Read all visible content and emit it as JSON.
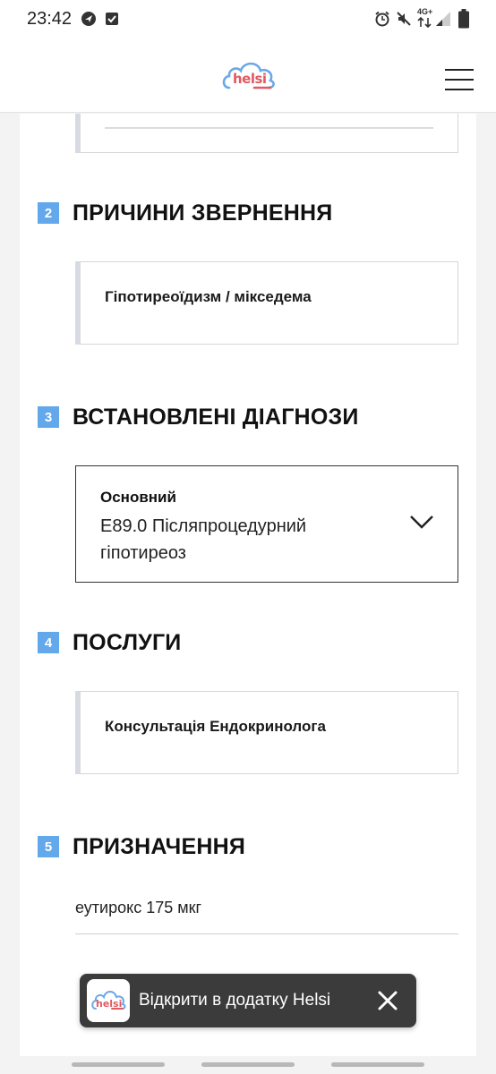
{
  "status_bar": {
    "time": "23:42",
    "network_label": "4G+",
    "icons": [
      "navigation-icon",
      "check-icon",
      "alarm-icon",
      "mute-icon",
      "network-icon",
      "signal-icon",
      "battery-icon"
    ]
  },
  "header": {
    "logo_text": "helsi",
    "menu_icon": "hamburger-menu-icon"
  },
  "sections": {
    "reasons": {
      "number": "2",
      "title": "ПРИЧИНИ ЗВЕРНЕННЯ",
      "item": "Гіпотиреоїдизм / мікседема"
    },
    "diagnoses": {
      "number": "3",
      "title": "ВСТАНОВЛЕНІ ДІАГНОЗИ",
      "label": "Основний",
      "value": "E89.0 Післяпроцедурний гіпотиреоз",
      "expand_icon": "chevron-down-icon"
    },
    "services": {
      "number": "4",
      "title": "ПОСЛУГИ",
      "item": "Консультація Ендокринолога"
    },
    "prescriptions": {
      "number": "5",
      "title": "ПРИЗНАЧЕННЯ",
      "item": "еутирокс 175 мкг"
    }
  },
  "app_banner": {
    "logo_text": "helsi",
    "text": "Відкрити в додатку Helsi",
    "close_icon": "close-icon"
  },
  "colors": {
    "accent": "#62a8ea",
    "logo_red": "#e05a62",
    "logo_blue": "#6aa8e8",
    "banner_bg": "#3b3b3b",
    "page_bg": "#f3f3f3"
  }
}
